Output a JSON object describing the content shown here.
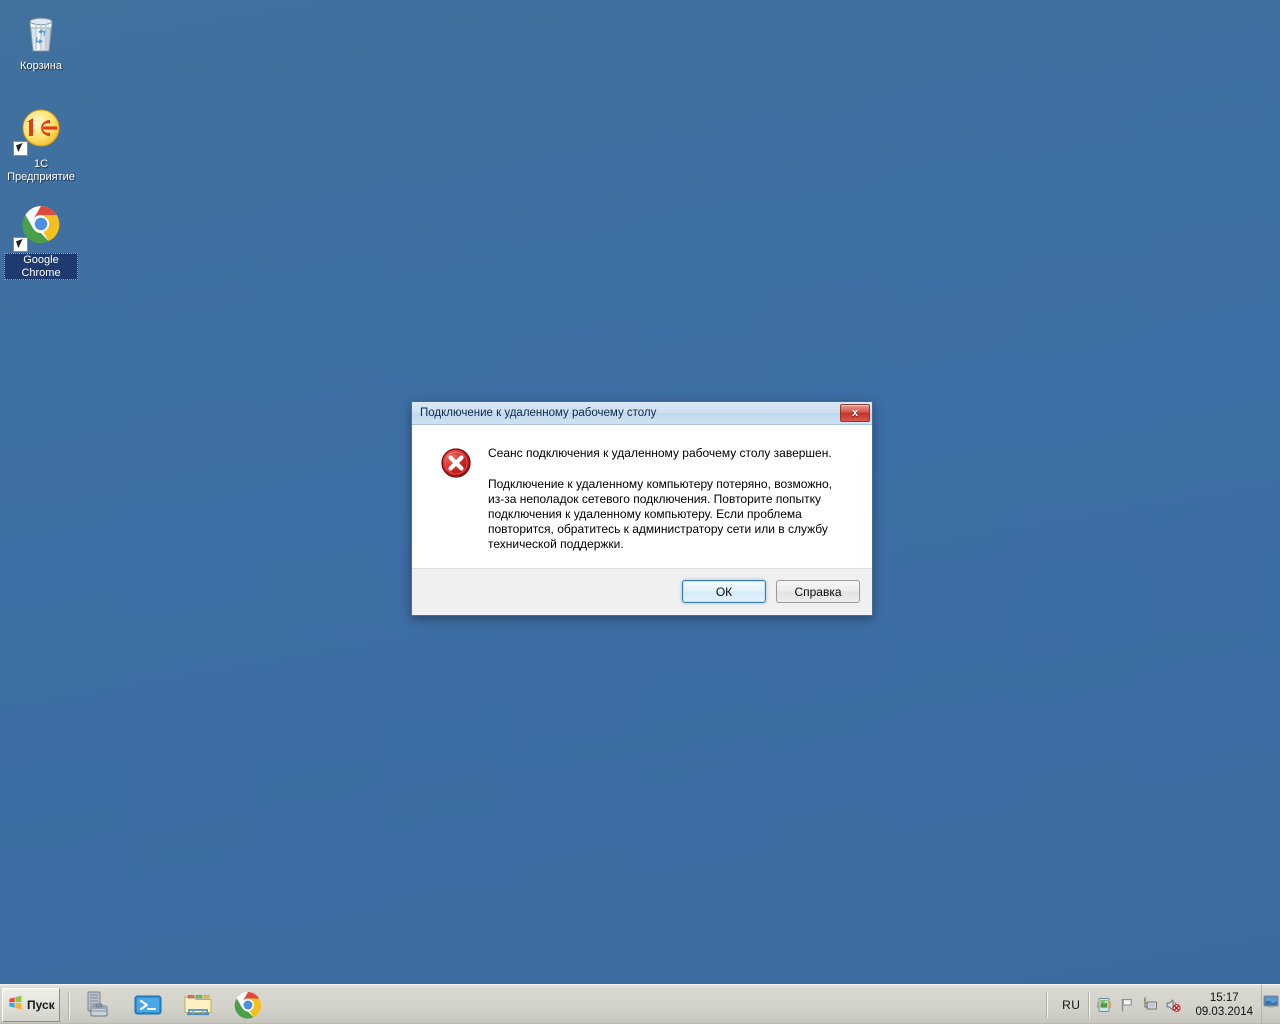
{
  "desktop": {
    "background_color": "#3d6ea5",
    "icons": [
      {
        "name": "recycle-bin",
        "label": "Корзина",
        "icon": "recycle-bin-icon",
        "shortcut": false,
        "selected": false
      },
      {
        "name": "1c-enterprise",
        "label": "1C\nПредприятие",
        "label_line1": "1C",
        "label_line2": "Предприятие",
        "icon": "1c-enterprise-icon",
        "shortcut": true,
        "selected": false
      },
      {
        "name": "google-chrome",
        "label": "Google Chrome",
        "label_line1": "Google",
        "label_line2": "Chrome",
        "icon": "chrome-icon",
        "shortcut": true,
        "selected": true
      }
    ]
  },
  "dialog": {
    "title": "Подключение к удаленному рабочему столу",
    "close_label": "x",
    "icon": "error-icon",
    "heading": "Сеанс подключения к удаленному рабочему столу завершен.",
    "body": "Подключение к удаленному компьютеру потеряно, возможно, из-за неполадок сетевого подключения. Повторите попытку подключения к удаленному компьютеру. Если проблема повторится, обратитесь к администратору сети или в службу технической поддержки.",
    "buttons": {
      "ok": "ОК",
      "help": "Справка"
    },
    "accent_color": "#3c7fb1",
    "error_color": "#c32020"
  },
  "taskbar": {
    "start_label": "Пуск",
    "quick_launch": [
      {
        "name": "server-manager",
        "icon": "server-manager-icon"
      },
      {
        "name": "powershell",
        "icon": "powershell-icon"
      },
      {
        "name": "file-explorer",
        "icon": "folder-icon"
      },
      {
        "name": "chrome",
        "icon": "chrome-icon"
      }
    ],
    "tray": {
      "language": "RU",
      "icons": [
        {
          "name": "action-center",
          "icon": "action-center-icon"
        },
        {
          "name": "flag",
          "icon": "flag-icon"
        },
        {
          "name": "network",
          "icon": "network-icon"
        },
        {
          "name": "volume-muted",
          "icon": "speaker-muted-icon"
        }
      ],
      "time": "15:17",
      "date": "09.03.2014"
    },
    "show_desktop": "show-desktop-icon"
  }
}
